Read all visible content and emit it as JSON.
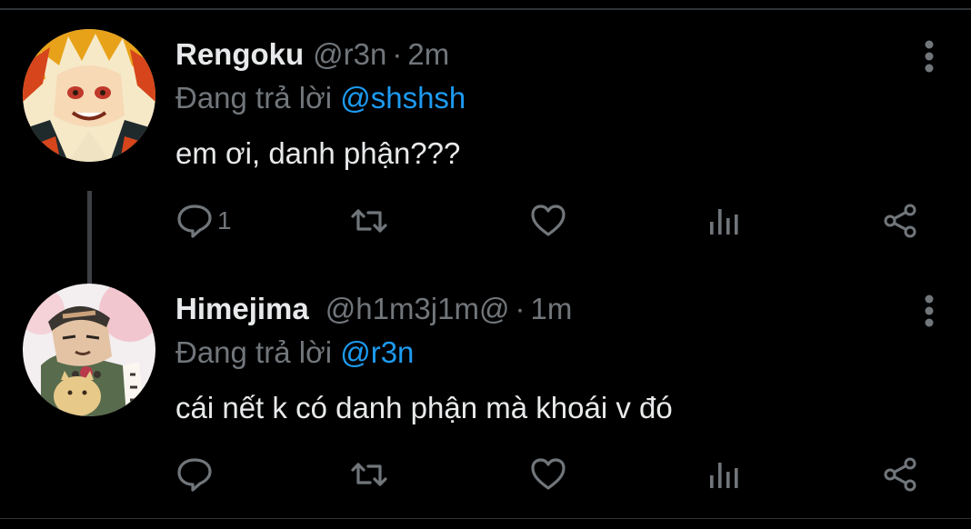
{
  "tweets": [
    {
      "name": "Rengoku",
      "handle": "@r3n",
      "separator": "·",
      "time": "2m",
      "reply_label": "Đang trả lời",
      "reply_to": "@shshsh",
      "text": "em ơi, danh phận???",
      "reply_count": "1",
      "avatar": "avatar-anime-flame-hair"
    },
    {
      "name": "Himejima",
      "handle": "@h1m3j1m@",
      "separator": "·",
      "time": "1m",
      "reply_label": "Đang trả lời",
      "reply_to": "@r3n",
      "text": "cái nết k có danh phận mà khoái v đó",
      "reply_count": "",
      "avatar": "avatar-anime-monk-with-cat"
    }
  ],
  "icons": {
    "reply": "reply-icon",
    "retweet": "retweet-icon",
    "like": "heart-icon",
    "views": "views-icon",
    "share": "share-icon",
    "more": "more-vertical-icon"
  },
  "colors": {
    "background": "#000000",
    "primary_text": "#e7e9ea",
    "secondary_text": "#71767b",
    "accent": "#1d9bf0",
    "separator": "#2f3336"
  }
}
